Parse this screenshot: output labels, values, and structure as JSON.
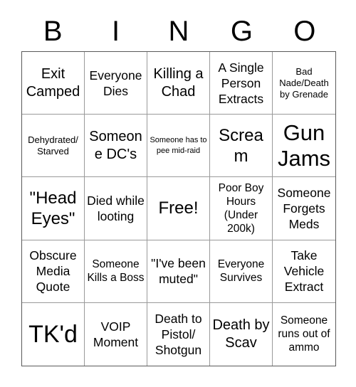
{
  "card": {
    "title": "BINGO",
    "header_letters": [
      "B",
      "I",
      "N",
      "G",
      "O"
    ],
    "rows": 5,
    "columns": 5,
    "text_color": "#000000",
    "background_color": "#ffffff",
    "border_color": "#9a9a9a",
    "outer_border_color": "#5a5a5a",
    "free_space_index": 12,
    "cells": [
      {
        "text": "Exit Camped",
        "size": "fs-l"
      },
      {
        "text": "Everyone Dies",
        "size": "fs-m"
      },
      {
        "text": "Killing a Chad",
        "size": "fs-l"
      },
      {
        "text": "A Single Person Extracts",
        "size": "fs-m"
      },
      {
        "text": "Bad Nade/Death by Grenade",
        "size": "fs-xs"
      },
      {
        "text": "Dehydrated/ Starved",
        "size": "fs-xs"
      },
      {
        "text": "Someone DC's",
        "size": "fs-l"
      },
      {
        "text": "Someone has to pee mid-raid",
        "size": "fs-xxs"
      },
      {
        "text": "Scream",
        "size": "fs-xl"
      },
      {
        "text": "Gun Jams",
        "size": "fs-xxl"
      },
      {
        "text": "\"Head Eyes\"",
        "size": "fs-xl"
      },
      {
        "text": "Died while looting",
        "size": "fs-m"
      },
      {
        "text": "Free!",
        "size": "fs-xl"
      },
      {
        "text": "Poor Boy Hours (Under 200k)",
        "size": "fs-s"
      },
      {
        "text": "Someone Forgets Meds",
        "size": "fs-m"
      },
      {
        "text": "Obscure Media Quote",
        "size": "fs-m"
      },
      {
        "text": "Someone Kills a Boss",
        "size": "fs-s"
      },
      {
        "text": "\"I've been muted\"",
        "size": "fs-m"
      },
      {
        "text": "Everyone Survives",
        "size": "fs-s"
      },
      {
        "text": "Take Vehicle Extract",
        "size": "fs-m"
      },
      {
        "text": "TK'd",
        "size": "fs-huge"
      },
      {
        "text": "VOIP Moment",
        "size": "fs-m"
      },
      {
        "text": "Death to Pistol/ Shotgun",
        "size": "fs-m"
      },
      {
        "text": "Death by Scav",
        "size": "fs-l"
      },
      {
        "text": "Someone runs out of ammo",
        "size": "fs-s"
      }
    ]
  }
}
